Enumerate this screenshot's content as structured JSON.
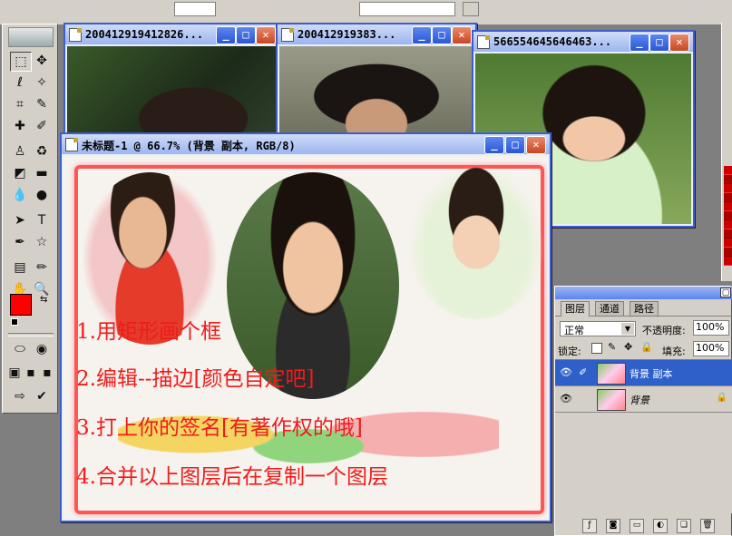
{
  "document_windows": [
    {
      "title": "200412919412826...",
      "minimize": "_",
      "maximize": "□",
      "close": "✕"
    },
    {
      "title": "200412919383...",
      "minimize": "_",
      "maximize": "□",
      "close": "✕"
    },
    {
      "title": "566554645646463...",
      "minimize": "_",
      "maximize": "□",
      "close": "✕"
    }
  ],
  "active_document": {
    "title": "未标题-1 @ 66.7% (背景 副本, RGB/8)",
    "minimize": "_",
    "maximize": "□",
    "close": "✕",
    "steps": [
      "1.用矩形画个框",
      "2.编辑--描边[颜色自定吧]",
      "3.打上你的签名[有著作权的哦]",
      "4.合并以上图层后在复制一个图层"
    ]
  },
  "toolbox": {
    "tools": [
      {
        "name": "marquee",
        "glyph": "⬚"
      },
      {
        "name": "move",
        "glyph": "✥"
      },
      {
        "name": "lasso",
        "glyph": "ℓ"
      },
      {
        "name": "magic-wand",
        "glyph": "✧"
      },
      {
        "name": "crop",
        "glyph": "⌗"
      },
      {
        "name": "slice",
        "glyph": "✎"
      },
      {
        "name": "healing-brush",
        "glyph": "✚"
      },
      {
        "name": "brush",
        "glyph": "✐"
      },
      {
        "name": "clone-stamp",
        "glyph": "♙"
      },
      {
        "name": "history-brush",
        "glyph": "♻"
      },
      {
        "name": "eraser",
        "glyph": "◩"
      },
      {
        "name": "gradient",
        "glyph": "▬"
      },
      {
        "name": "blur",
        "glyph": "💧"
      },
      {
        "name": "dodge",
        "glyph": "●"
      },
      {
        "name": "path-selection",
        "glyph": "➤"
      },
      {
        "name": "type",
        "glyph": "T"
      },
      {
        "name": "pen",
        "glyph": "✒"
      },
      {
        "name": "shape",
        "glyph": "☆"
      },
      {
        "name": "notes",
        "glyph": "▤"
      },
      {
        "name": "eyedropper",
        "glyph": "✏"
      },
      {
        "name": "hand",
        "glyph": "✋"
      },
      {
        "name": "zoom",
        "glyph": "🔍"
      }
    ],
    "foreground_color": "#ff0000",
    "background_color": "#b8d89a"
  },
  "layers_panel": {
    "tabs": [
      "图层",
      "通道",
      "路径"
    ],
    "blend_mode": "正常",
    "opacity_label": "不透明度:",
    "opacity_value": "100%",
    "lock_label": "锁定:",
    "fill_label": "填充:",
    "fill_value": "100%",
    "layers": [
      {
        "name": "背景 副本",
        "selected": true
      },
      {
        "name": "背景",
        "selected": false
      }
    ]
  }
}
